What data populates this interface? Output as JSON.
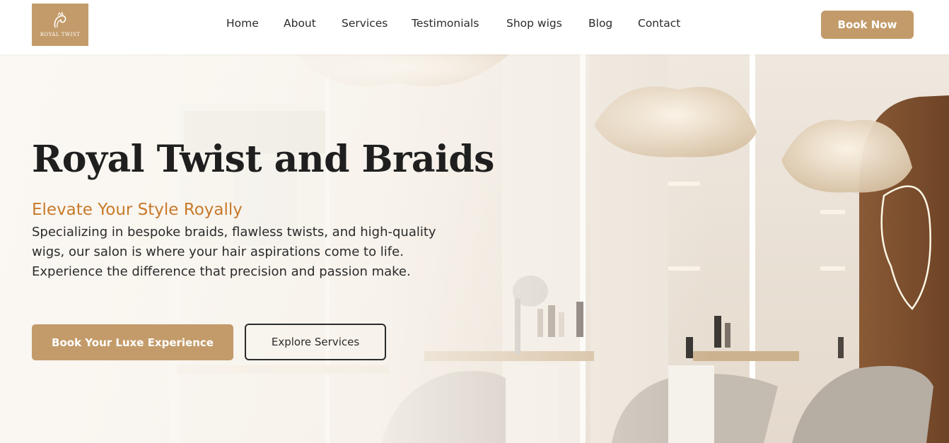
{
  "brand": {
    "logo_text": "ROYAL TWIST",
    "accent_color": "#c39b6a",
    "subtitle_color": "#c87a2b"
  },
  "nav": {
    "items": [
      {
        "label": "Home"
      },
      {
        "label": "About"
      },
      {
        "label": "Services"
      },
      {
        "label": "Testimonials"
      },
      {
        "label": "Shop wigs"
      },
      {
        "label": "Blog"
      },
      {
        "label": "Contact"
      }
    ],
    "cta_label": "Book Now"
  },
  "hero": {
    "title": "Royal Twist and Braids",
    "subtitle": "Elevate Your Style Royally",
    "description": "Specializing in bespoke braids, flawless twists, and high-quality wigs, our salon is where your hair aspirations come to life. Experience the difference that precision and passion make.",
    "primary_button": "Book Your Luxe Experience",
    "secondary_button": "Explore Services",
    "background_image": "salon-interior"
  }
}
